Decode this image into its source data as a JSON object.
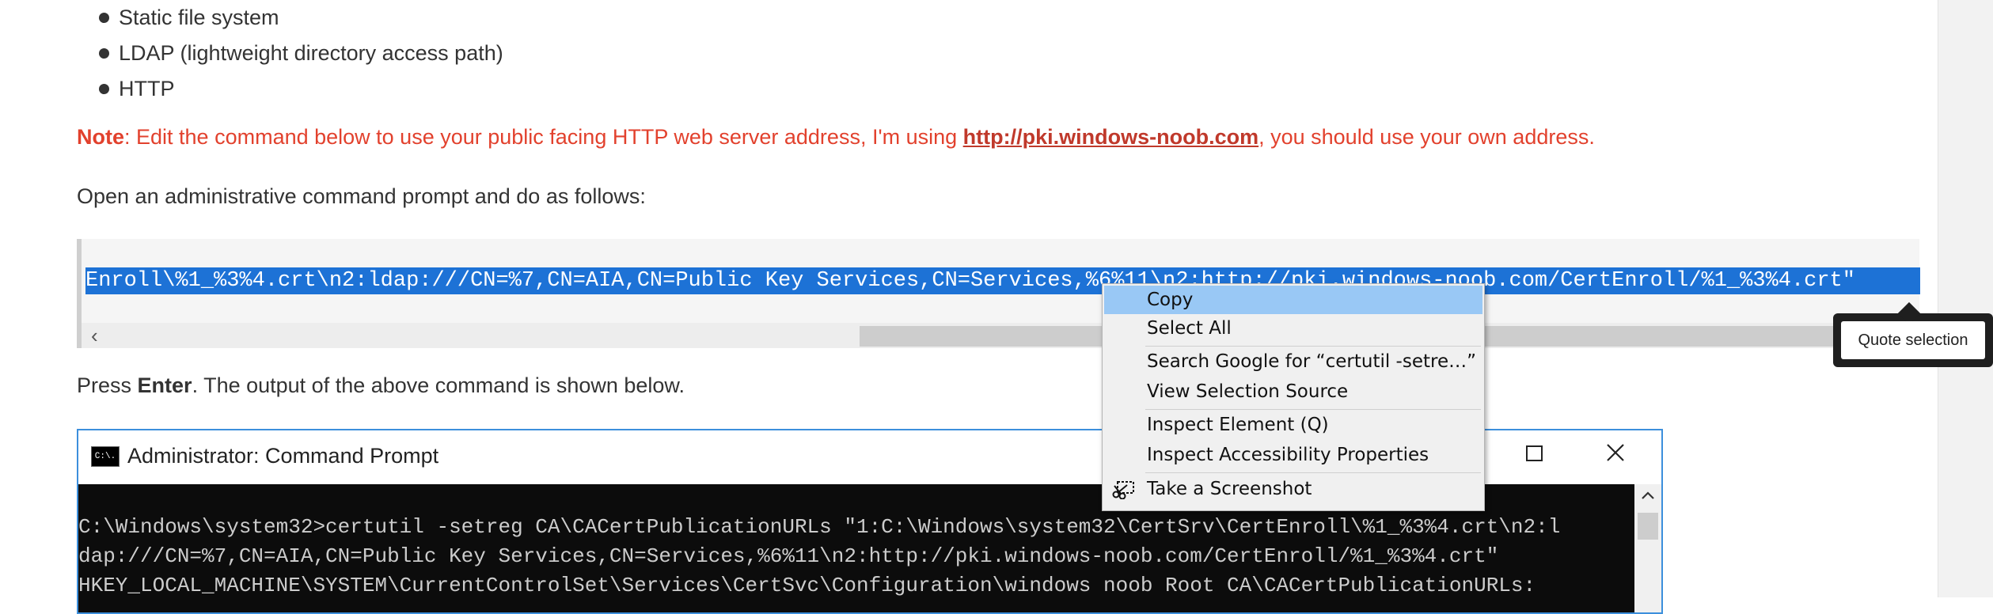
{
  "bullets": [
    "Static file system",
    "LDAP (lightweight directory access path)",
    "HTTP"
  ],
  "note": {
    "label": "Note",
    "text_before": ": Edit the command below to use your public facing HTTP web server address, I'm using ",
    "link": "http://pki.windows-noob.com",
    "text_after": ", you should use your own address."
  },
  "intro": "Open an administrative command prompt and do as follows:",
  "code_visible": "Enroll\\%1_%3%4.crt\\n2:ldap:///CN=%7,CN=AIA,CN=Public Key Services,CN=Services,%6%11\\n2:http://pki.windows-noob.com/CertEnroll/%1_%3%4.crt\"",
  "code_scroll_left_arrow": "‹",
  "press": {
    "before": "Press ",
    "key": "Enter",
    "after": ". The output of the above command is shown below."
  },
  "cmd_window": {
    "icon_text": "C:\\.",
    "title": "Administrator: Command Prompt",
    "lines": [
      "C:\\Windows\\system32>certutil -setreg CA\\CACertPublicationURLs \"1:C:\\Windows\\system32\\CertSrv\\CertEnroll\\%1_%3%4.crt\\n2:l",
      "dap:///CN=%7,CN=AIA,CN=Public Key Services,CN=Services,%6%11\\n2:http://pki.windows-noob.com/CertEnroll/%1_%3%4.crt\"",
      "HKEY_LOCAL_MACHINE\\SYSTEM\\CurrentControlSet\\Services\\CertSvc\\Configuration\\windows noob Root CA\\CACertPublicationURLs:"
    ]
  },
  "context_menu": {
    "copy": "Copy",
    "select_all": "Select All",
    "search_google": "Search Google for “certutil -setre…”",
    "view_source": "View Selection Source",
    "inspect_element": "Inspect Element (Q)",
    "inspect_accessibility": "Inspect Accessibility Properties",
    "take_screenshot": "Take a Screenshot"
  },
  "quote_tooltip": "Quote selection",
  "colors": {
    "note_red": "#e2412d",
    "selection_blue": "#1d72d6",
    "menu_highlight": "#99c8f5"
  }
}
